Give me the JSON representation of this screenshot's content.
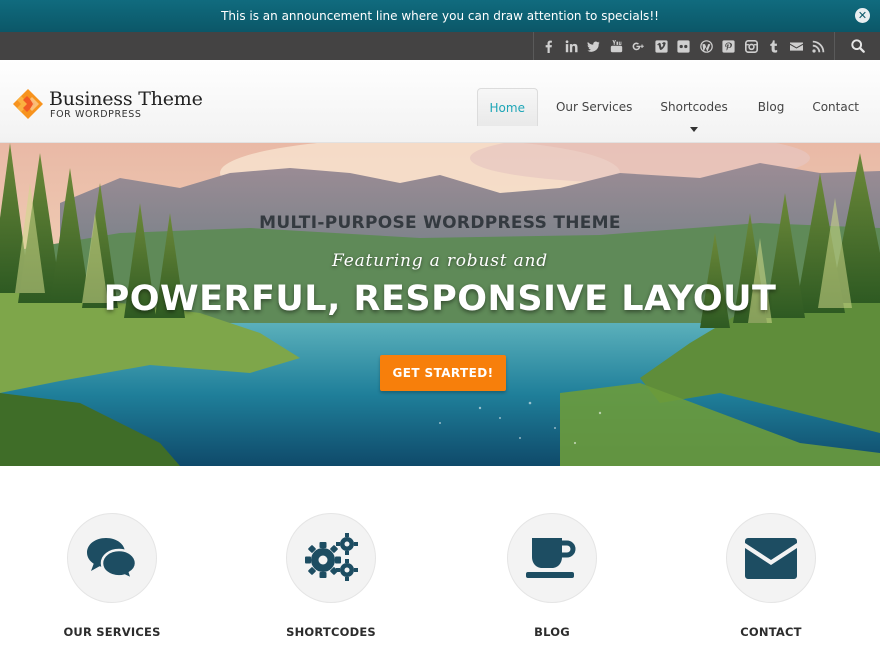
{
  "announcement": {
    "text": "This is an announcement line where you can draw attention to specials!!",
    "close_icon": "close-icon",
    "close_glyph": "✕"
  },
  "social": {
    "icons": [
      "facebook-icon",
      "linkedin-icon",
      "twitter-icon",
      "youtube-icon",
      "google-plus-icon",
      "vimeo-icon",
      "flickr-icon",
      "wordpress-icon",
      "pinterest-icon",
      "instagram-icon",
      "tumblr-icon",
      "email-icon",
      "rss-icon"
    ],
    "search_icon": "search-icon"
  },
  "logo": {
    "title": "Business Theme",
    "subtitle": "FOR WORDPRESS"
  },
  "nav": {
    "items": [
      {
        "label": "Home",
        "active": true
      },
      {
        "label": "Our Services"
      },
      {
        "label": "Shortcodes",
        "has_dropdown": true
      },
      {
        "label": "Blog"
      },
      {
        "label": "Contact"
      }
    ]
  },
  "hero": {
    "kicker": "MULTI-PURPOSE WORDPRESS THEME",
    "subtitle": "Featuring a robust and",
    "title": "POWERFUL, RESPONSIVE LAYOUT",
    "cta_label": "GET STARTED!"
  },
  "features": [
    {
      "label": "OUR SERVICES",
      "icon": "chat-bubbles-icon"
    },
    {
      "label": "SHORTCODES",
      "icon": "gears-icon"
    },
    {
      "label": "BLOG",
      "icon": "coffee-cup-icon"
    },
    {
      "label": "CONTACT",
      "icon": "envelope-icon"
    }
  ],
  "colors": {
    "announcement_bg": "#0b5768",
    "social_bar_bg": "#444343",
    "accent": "#1ea6b7",
    "cta": "#f77f0b",
    "feature_icon": "#1d4d62",
    "logo_orange": "#f7931e"
  }
}
